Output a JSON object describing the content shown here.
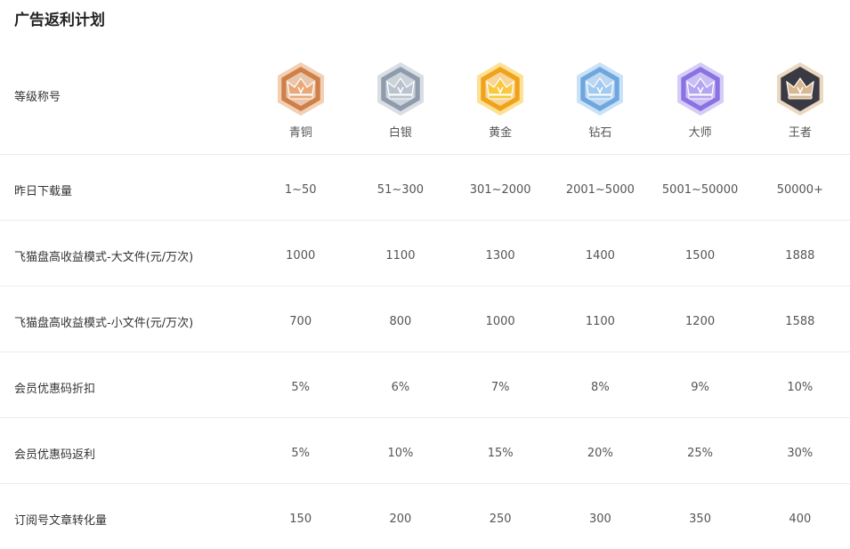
{
  "title": "广告返利计划",
  "labels": {
    "tier": "等级称号",
    "downloads": "昨日下载量",
    "big_file": "飞猫盘高收益模式-大文件(元/万次)",
    "small_file": "飞猫盘高收益模式-小文件(元/万次)",
    "discount": "会员优惠码折扣",
    "rebate": "会员优惠码返利",
    "conversion": "订阅号文章转化量"
  },
  "tiers": [
    {
      "name": "青铜",
      "icon": "bronze-crown-badge-icon",
      "color": "#e9a877",
      "dark": "#cf7f48",
      "downloads": "1~50",
      "big_file": "1000",
      "small_file": "700",
      "discount": "5%",
      "rebate": "5%",
      "conversion": "150"
    },
    {
      "name": "白银",
      "icon": "silver-crown-badge-icon",
      "color": "#b9c3cf",
      "dark": "#8e9bac",
      "downloads": "51~300",
      "big_file": "1100",
      "small_file": "800",
      "discount": "6%",
      "rebate": "10%",
      "conversion": "200"
    },
    {
      "name": "黄金",
      "icon": "gold-crown-badge-icon",
      "color": "#f9c83f",
      "dark": "#f0a21a",
      "downloads": "301~2000",
      "big_file": "1300",
      "small_file": "1000",
      "discount": "7%",
      "rebate": "15%",
      "conversion": "250"
    },
    {
      "name": "钻石",
      "icon": "diamond-crown-badge-icon",
      "color": "#9fcaf1",
      "dark": "#6ea6de",
      "downloads": "2001~5000",
      "big_file": "1400",
      "small_file": "1100",
      "discount": "8%",
      "rebate": "20%",
      "conversion": "300"
    },
    {
      "name": "大师",
      "icon": "master-crown-badge-icon",
      "color": "#b4a4f1",
      "dark": "#8a72e4",
      "downloads": "5001~50000",
      "big_file": "1500",
      "small_file": "1200",
      "discount": "9%",
      "rebate": "25%",
      "conversion": "350"
    },
    {
      "name": "王者",
      "icon": "king-crown-badge-icon",
      "color": "#d8b88e",
      "dark": "#3b3a44",
      "downloads": "50000+",
      "big_file": "1888",
      "small_file": "1588",
      "discount": "10%",
      "rebate": "30%",
      "conversion": "400"
    }
  ]
}
